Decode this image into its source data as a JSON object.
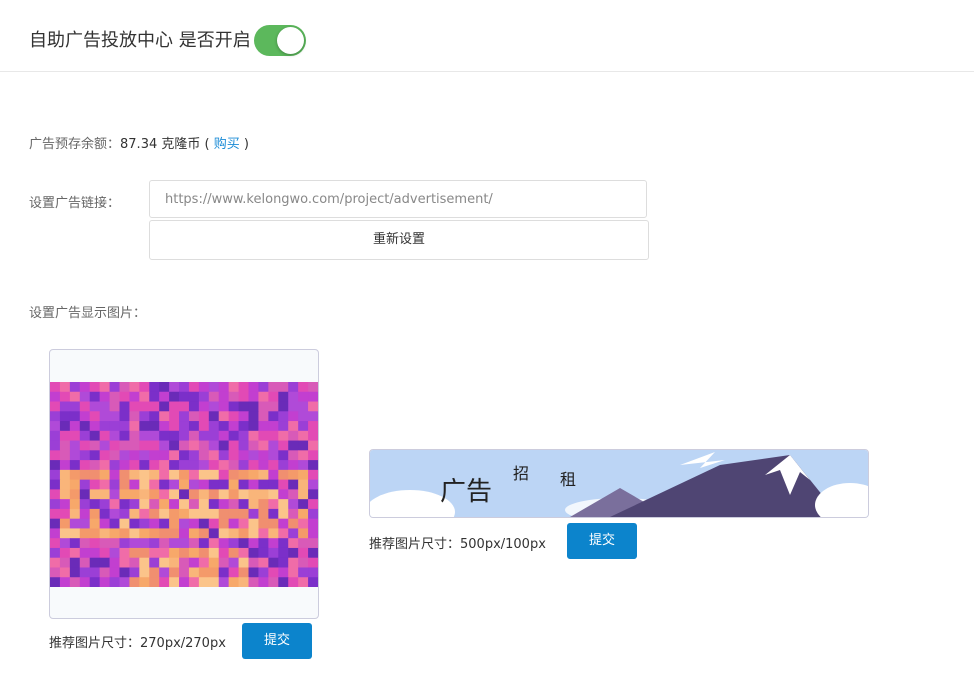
{
  "header": {
    "title": "自助广告投放中心 是否开启",
    "toggle_on": true,
    "toggle_color": "#5cb85c"
  },
  "balance": {
    "label": "广告预存余额：",
    "amount": "87.34 克隆币",
    "open": "(",
    "buy_link": "购买",
    "close": ")"
  },
  "ad_link": {
    "label": "设置广告链接：",
    "placeholder": "https://www.kelongwo.com/project/advertisement/",
    "reset_label": "重新设置"
  },
  "ad_image": {
    "label": "设置广告显示图片：",
    "square": {
      "hint": "推荐图片尺寸：270px/270px",
      "submit_label": "提交"
    },
    "wide": {
      "hint": "推荐图片尺寸：500px/100px",
      "submit_label": "提交",
      "banner_text_1": "广告",
      "banner_text_2": "招",
      "banner_text_3": "租"
    }
  },
  "colors": {
    "accent": "#0c84cc",
    "link": "#1a8bd6"
  }
}
